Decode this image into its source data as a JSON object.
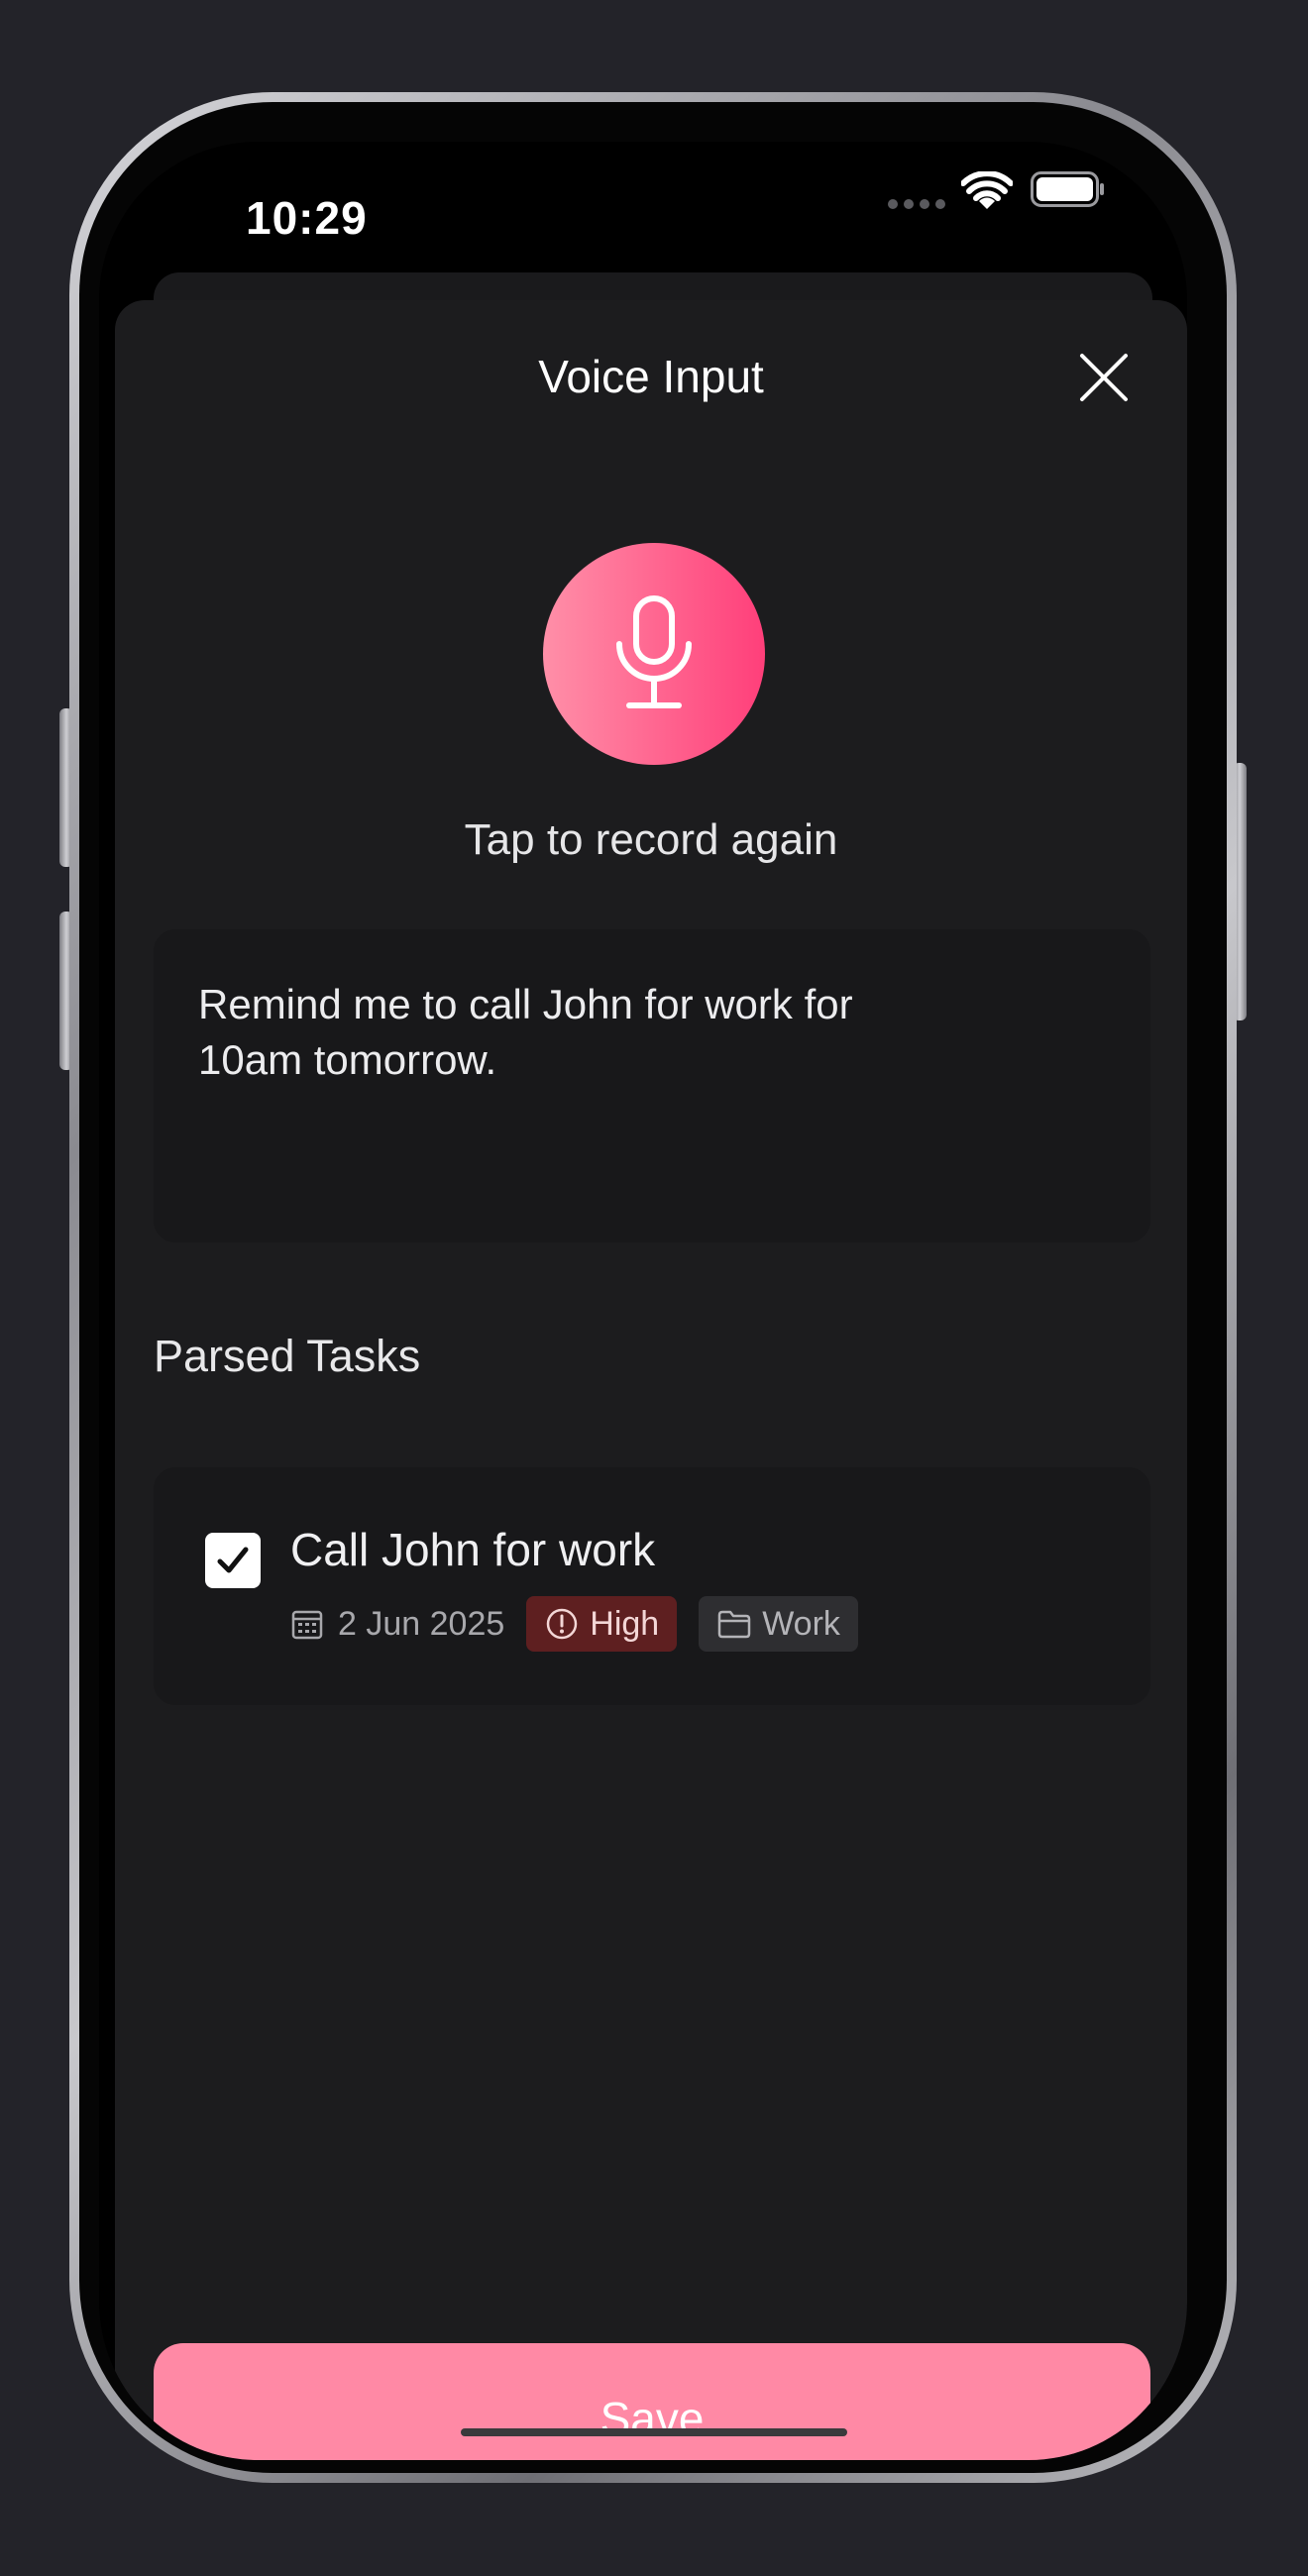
{
  "status_bar": {
    "time": "10:29",
    "icons": [
      "signal-dots-icon",
      "wifi-icon",
      "battery-icon"
    ]
  },
  "sheet": {
    "title": "Voice Input",
    "close_icon": "close-icon"
  },
  "recorder": {
    "mic_icon": "microphone-icon",
    "hint": "Tap to record again",
    "gradient_start": "#ff8fa8",
    "gradient_end": "#ff3f7a"
  },
  "transcript": {
    "text": "Remind me to call John for work for 10am tomorrow."
  },
  "parsed_tasks": {
    "label": "Parsed Tasks",
    "items": [
      {
        "checked": true,
        "title": "Call John for work",
        "date": "2 Jun 2025",
        "date_icon": "calendar-icon",
        "priority": "High",
        "priority_icon": "alert-circle-icon",
        "priority_color": "#5e1f20",
        "category": "Work",
        "category_icon": "folder-icon"
      }
    ]
  },
  "footer": {
    "save_label": "Save",
    "save_color": "#ff89a5"
  }
}
